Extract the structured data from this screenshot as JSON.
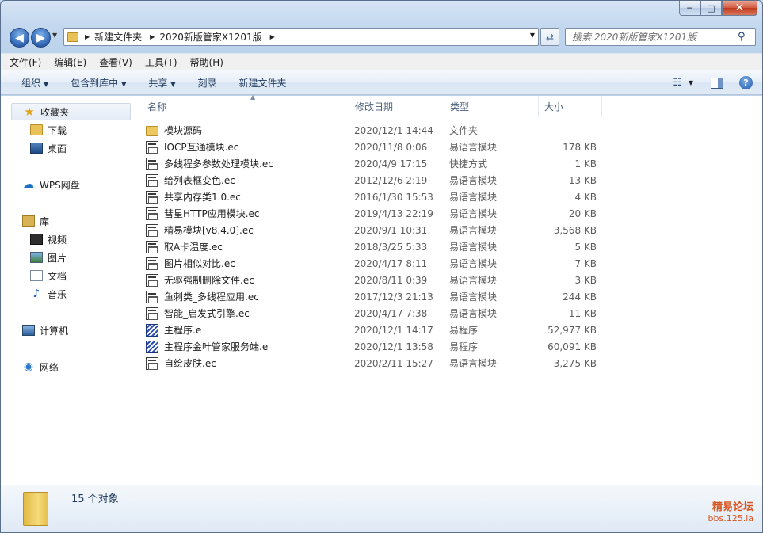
{
  "window": {
    "controls": {
      "minimize": "─",
      "maximize": "□",
      "close": "✕"
    }
  },
  "address": {
    "crumbs": [
      "新建文件夹",
      "2020新版管家X1201版"
    ]
  },
  "search": {
    "placeholder": "搜索 2020新版管家X1201版"
  },
  "menu": [
    "文件(F)",
    "编辑(E)",
    "查看(V)",
    "工具(T)",
    "帮助(H)"
  ],
  "commands": {
    "organize": "组织",
    "include_library": "包含到库中",
    "share": "共享",
    "burn": "刻录",
    "new_folder": "新建文件夹"
  },
  "nav": {
    "favorites": "收藏夹",
    "downloads": "下载",
    "desktop": "桌面",
    "wps": "WPS网盘",
    "libraries": "库",
    "videos": "视频",
    "pictures": "图片",
    "documents": "文档",
    "music": "音乐",
    "computer": "计算机",
    "network": "网络"
  },
  "columns": {
    "name": "名称",
    "date": "修改日期",
    "type": "类型",
    "size": "大小"
  },
  "files": [
    {
      "name": "模块源码",
      "date": "2020/12/1 14:44",
      "type": "文件夹",
      "size": "",
      "icon": "folder-icon"
    },
    {
      "name": "IOCP互通模块.ec",
      "date": "2020/11/8 0:06",
      "type": "易语言模块",
      "size": "178 KB",
      "icon": "ec-module-icon"
    },
    {
      "name": "多线程多参数处理模块.ec",
      "date": "2020/4/9 17:15",
      "type": "快捷方式",
      "size": "1 KB",
      "icon": "ec-module-icon"
    },
    {
      "name": "给列表框变色.ec",
      "date": "2012/12/6 2:19",
      "type": "易语言模块",
      "size": "13 KB",
      "icon": "ec-module-icon"
    },
    {
      "name": "共享内存类1.0.ec",
      "date": "2016/1/30 15:53",
      "type": "易语言模块",
      "size": "4 KB",
      "icon": "ec-module-icon"
    },
    {
      "name": "彗星HTTP应用模块.ec",
      "date": "2019/4/13 22:19",
      "type": "易语言模块",
      "size": "20 KB",
      "icon": "ec-module-icon"
    },
    {
      "name": "精易模块[v8.4.0].ec",
      "date": "2020/9/1 10:31",
      "type": "易语言模块",
      "size": "3,568 KB",
      "icon": "ec-module-icon"
    },
    {
      "name": "取A卡温度.ec",
      "date": "2018/3/25 5:33",
      "type": "易语言模块",
      "size": "5 KB",
      "icon": "ec-module-icon"
    },
    {
      "name": "图片相似对比.ec",
      "date": "2020/4/17 8:11",
      "type": "易语言模块",
      "size": "7 KB",
      "icon": "ec-module-icon"
    },
    {
      "name": "无驱强制删除文件.ec",
      "date": "2020/8/11 0:39",
      "type": "易语言模块",
      "size": "3 KB",
      "icon": "ec-module-icon"
    },
    {
      "name": "鱼刺类_多线程应用.ec",
      "date": "2017/12/3 21:13",
      "type": "易语言模块",
      "size": "244 KB",
      "icon": "ec-module-icon"
    },
    {
      "name": "智能_启发式引擎.ec",
      "date": "2020/4/17 7:38",
      "type": "易语言模块",
      "size": "11 KB",
      "icon": "ec-module-icon"
    },
    {
      "name": "主程序.e",
      "date": "2020/12/1 14:17",
      "type": "易程序",
      "size": "52,977 KB",
      "icon": "e-program-icon"
    },
    {
      "name": "主程序金叶管家服务端.e",
      "date": "2020/12/1 13:58",
      "type": "易程序",
      "size": "60,091 KB",
      "icon": "e-program-icon"
    },
    {
      "name": "自绘皮肤.ec",
      "date": "2020/2/11 15:27",
      "type": "易语言模块",
      "size": "3,275 KB",
      "icon": "ec-module-icon"
    }
  ],
  "status": {
    "count": "15 个对象"
  },
  "watermark": {
    "line1": "精易论坛",
    "line2": "bbs.125.la"
  }
}
